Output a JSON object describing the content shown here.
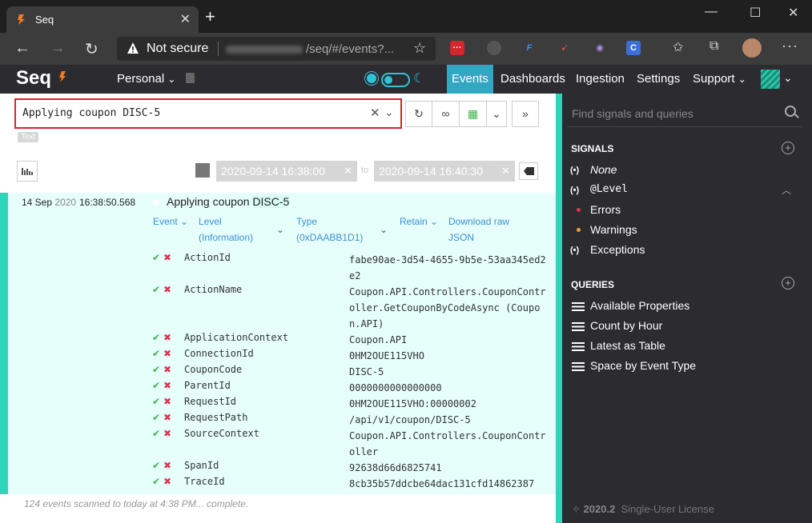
{
  "browser": {
    "tab_title": "Seq",
    "not_secure": "Not secure",
    "url": "/seq/#/events?..."
  },
  "app": {
    "logo": "Seq",
    "workspace": "Personal",
    "nav": [
      "Events",
      "Dashboards",
      "Ingestion",
      "Settings",
      "Support"
    ]
  },
  "search": {
    "value": "Applying coupon DISC-5",
    "type_badge": "Text"
  },
  "range": {
    "from": "2020-09-14 16:38:00",
    "to_label": "to",
    "to": "2020-09-14 16:40:30"
  },
  "event": {
    "date": "14 Sep",
    "year": "2020",
    "time": "16:38:50.568",
    "message_prefix": "Applying coupon ",
    "message_highlight": "DISC-5",
    "links": {
      "event": "Event",
      "level_line1": "Level",
      "level_line2": "(Information)",
      "type_line1": "Type",
      "type_line2": "(0xDAABB1D1)",
      "retain": "Retain",
      "download_line1": "Download raw",
      "download_line2": "JSON"
    },
    "properties": [
      {
        "name": "ActionId",
        "value": "fabe90ae-3d54-4655-9b5e-53aa345ed2e2"
      },
      {
        "name": "ActionName",
        "value": "Coupon.API.Controllers.CouponController.GetCouponByCodeAsync (Coupon.API)"
      },
      {
        "name": "ApplicationContext",
        "value": "Coupon.API"
      },
      {
        "name": "ConnectionId",
        "value": "0HM2OUE115VHO"
      },
      {
        "name": "CouponCode",
        "value": "DISC-5"
      },
      {
        "name": "ParentId",
        "value": "0000000000000000"
      },
      {
        "name": "RequestId",
        "value": "0HM2OUE115VHO:00000002"
      },
      {
        "name": "RequestPath",
        "value": "/api/v1/coupon/DISC-5"
      },
      {
        "name": "SourceContext",
        "value": "Coupon.API.Controllers.CouponController"
      },
      {
        "name": "SpanId",
        "value": "92638d66d6825741"
      },
      {
        "name": "TraceId",
        "value": "8cb35b57ddcbe64dac131cfd14862387"
      }
    ]
  },
  "status": "124 events scanned to today at 4:38 PM... complete.",
  "sidebar": {
    "search_placeholder": "Find signals and queries",
    "signals_title": "SIGNALS",
    "signals": {
      "none": "None",
      "level": "@Level",
      "errors": "Errors",
      "warnings": "Warnings",
      "exceptions": "Exceptions"
    },
    "queries_title": "QUERIES",
    "queries": [
      "Available Properties",
      "Count by Hour",
      "Latest as Table",
      "Space by Event Type"
    ],
    "version": "2020.2",
    "license": "Single-User License"
  },
  "colors": {
    "accent": "#2fd4bb",
    "nav_active": "#31a7c2",
    "error_dot": "#e0364f",
    "warning_dot": "#f0a030"
  }
}
